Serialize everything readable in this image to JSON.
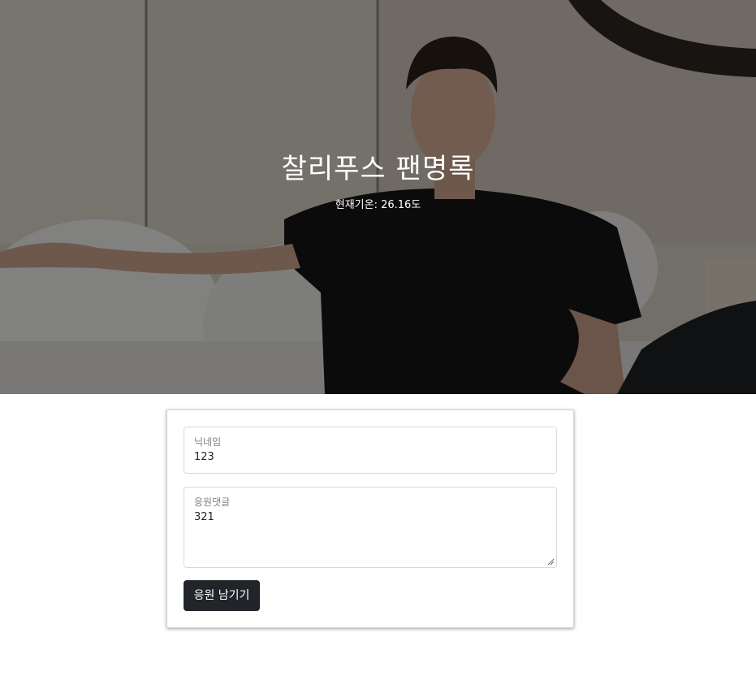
{
  "hero": {
    "title": "찰리푸스 팬명록",
    "weather": "현재기온: 26.16도",
    "image_subject": "person-on-bed-photo"
  },
  "form": {
    "nickname": {
      "label": "닉네임",
      "value": "123"
    },
    "comment": {
      "label": "응원댓글",
      "value": "321"
    },
    "submit_label": "응원 남기기"
  },
  "colors": {
    "hero_overlay": "#000000",
    "button_bg": "#212529",
    "button_text": "#ffffff",
    "field_border": "#d6d9dc",
    "label_text": "#7a7e83"
  }
}
